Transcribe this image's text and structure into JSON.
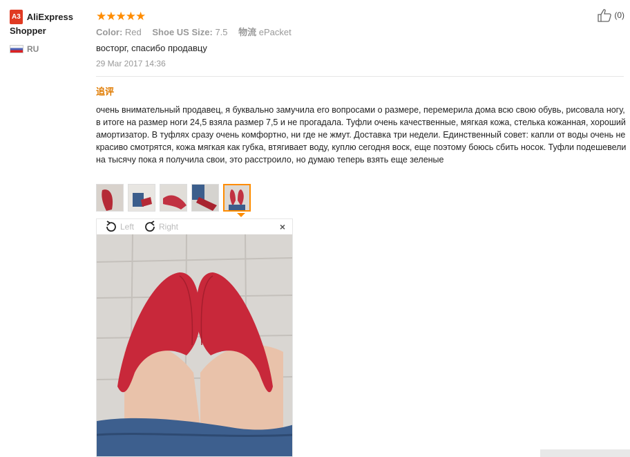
{
  "user": {
    "level_badge": "A3",
    "name": "AliExpress Shopper",
    "country_code": "RU"
  },
  "review": {
    "rating": 5,
    "stars": "★★★★★",
    "attributes": [
      {
        "label": "Color:",
        "value": "Red"
      },
      {
        "label": "Shoe US Size:",
        "value": "7.5"
      },
      {
        "label": "物流",
        "value": "ePacket"
      }
    ],
    "text": "восторг, спасибо продавцу",
    "date": "29 Mar 2017 14:36",
    "likes": "(0)"
  },
  "followup": {
    "label": "追评",
    "text": "очень внимательный продавец, я буквально замучила его вопросами о размере, перемерила дома всю свою обувь, рисовала ногу, в итоге на размер ноги 24,5 взяла размер 7,5 и не прогадала. Туфли очень качественные, мягкая кожа, стелька кожанная, хороший амортизатор. В туфлях сразу очень комфортно, ни где не жмут. Доставка три недели. Единственный совет: капли от воды очень не красиво смотрятся, кожа мягкая как губка, втягивает воду, куплю сегодня воск, еще поэтому боюсь сбить носок. Туфли подешевели на тысячу пока я получила свои, это расстроило, но думаю теперь взять еще зеленые"
  },
  "viewer": {
    "rotate_left": "Left",
    "rotate_right": "Right",
    "close": "×",
    "selected_thumb_index": 4
  },
  "colors": {
    "star": "#ff8c00",
    "followup_label": "#e07b00",
    "badge": "#e03a22",
    "shoe": "#c8283a"
  },
  "icons": {
    "like": "thumbs-up-icon",
    "rotate_left": "rotate-left-icon",
    "rotate_right": "rotate-right-icon",
    "close": "close-icon"
  }
}
